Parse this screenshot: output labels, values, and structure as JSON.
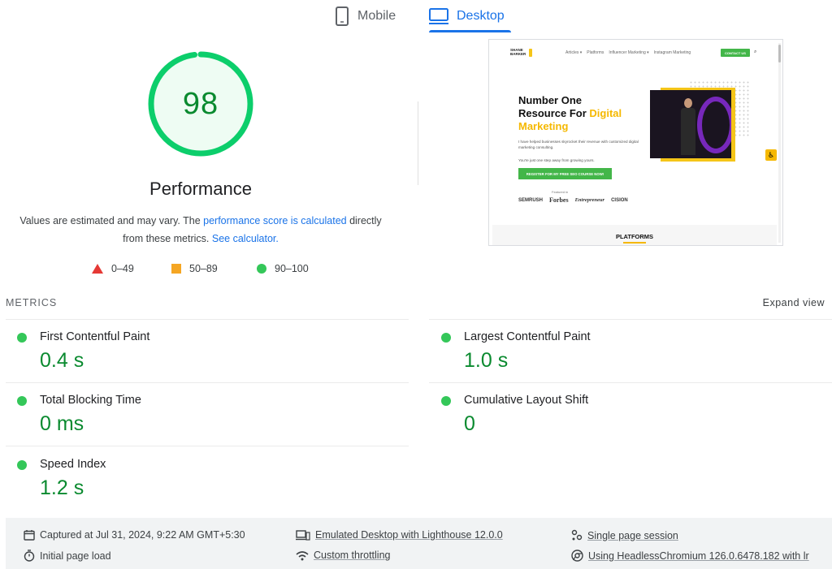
{
  "tabs": [
    {
      "label": "Mobile",
      "icon": "phone-icon",
      "selected": false
    },
    {
      "label": "Desktop",
      "icon": "monitor-icon",
      "selected": true
    }
  ],
  "score": {
    "value": "98",
    "fraction": 0.98,
    "color": "#0cce6b",
    "title": "Performance",
    "desc_part1": "Values are estimated and may vary. The ",
    "desc_link1": "performance score is calculated",
    "desc_part2": " directly from these metrics. ",
    "desc_link2": "See calculator."
  },
  "legend": {
    "fail": "0–49",
    "average": "50–89",
    "pass": "90–100",
    "colors": {
      "fail": "#e53935",
      "average": "#f5a623",
      "pass": "#34c759"
    }
  },
  "thumbnail": {
    "logo_line1": "SHANE",
    "logo_line2": "BARKER",
    "nav": [
      "Articles ▾",
      "Platforms",
      "Influencer Marketing ▾",
      "Instagram Marketing"
    ],
    "contact": "CONTACT US",
    "hero_title_1": "Number One",
    "hero_title_2": "Resource For ",
    "hero_title_hl": "Digital Marketing",
    "hero_text": "I have helped businesses skyrocket their revenue with customized digital marketing consulting.",
    "hero_text2": "You're just one step away from growing yours.",
    "hero_button": "REGISTER FOR MY FREE SEO COURSE NOW!",
    "featured": "Featured in",
    "brands": [
      "SEMRUSH",
      "Forbes",
      "Entrepreneur",
      "CISION"
    ],
    "platforms": "PLATFORMS"
  },
  "metrics": {
    "header": "METRICS",
    "expand": "Expand view",
    "items": [
      {
        "label": "First Contentful Paint",
        "value": "0.4 s"
      },
      {
        "label": "Largest Contentful Paint",
        "value": "1.0 s"
      },
      {
        "label": "Total Blocking Time",
        "value": "0 ms"
      },
      {
        "label": "Cumulative Layout Shift",
        "value": "0"
      },
      {
        "label": "Speed Index",
        "value": "1.2 s"
      }
    ]
  },
  "footer": {
    "captured": "Captured at Jul 31, 2024, 9:22 AM GMT+5:30",
    "initial_load": "Initial page load",
    "emulated": "Emulated Desktop with Lighthouse 12.0.0",
    "throttling": "Custom throttling",
    "session": "Single page session",
    "browser": "Using HeadlessChromium 126.0.6478.182 with lr"
  }
}
